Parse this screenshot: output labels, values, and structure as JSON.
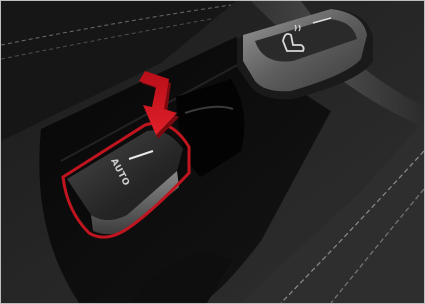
{
  "photo": {
    "auto_button_label": "AUTO",
    "highlight_color": "#c0151f",
    "arrow_color": "#d0101c",
    "seat_heater_icon": "seat-heater-icon"
  }
}
